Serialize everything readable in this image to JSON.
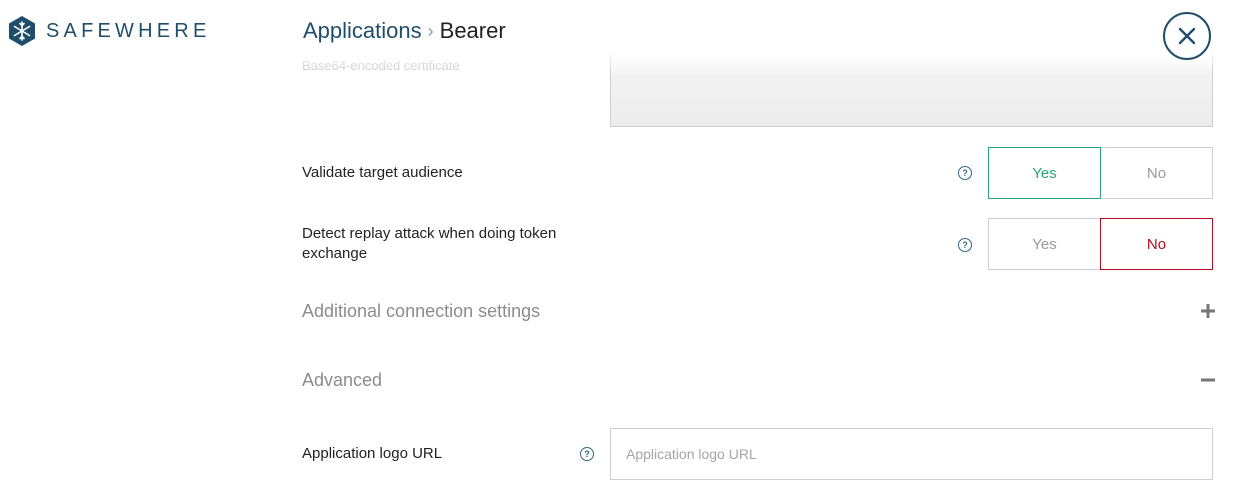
{
  "brand": {
    "name": "SAFEWHERE",
    "color": "#1f4e6a",
    "icon": "snowflake-hexagon-icon"
  },
  "breadcrumb": {
    "parent": "Applications",
    "separator": "›",
    "current": "Bearer"
  },
  "close_icon": "close-icon",
  "certificate": {
    "label": "Base64-encoded certificate",
    "value": ""
  },
  "settings": [
    {
      "label": "Validate target audience",
      "help_icon": "question-icon",
      "yes_label": "Yes",
      "no_label": "No",
      "selected": "Yes"
    },
    {
      "label": "Detect replay attack when doing token exchange",
      "help_icon": "question-icon",
      "yes_label": "Yes",
      "no_label": "No",
      "selected": "No"
    }
  ],
  "sections": {
    "additional": {
      "title": "Additional connection settings",
      "state": "collapsed",
      "icon": "plus-icon"
    },
    "advanced": {
      "title": "Advanced",
      "state": "expanded",
      "icon": "minus-icon"
    }
  },
  "logo_url": {
    "label": "Application logo URL",
    "help_icon": "question-icon",
    "placeholder": "Application logo URL",
    "value": ""
  },
  "colors": {
    "yes_active": "#2aa57a",
    "no_active": "#b00e1e",
    "inactive": "#9a9a9a"
  }
}
